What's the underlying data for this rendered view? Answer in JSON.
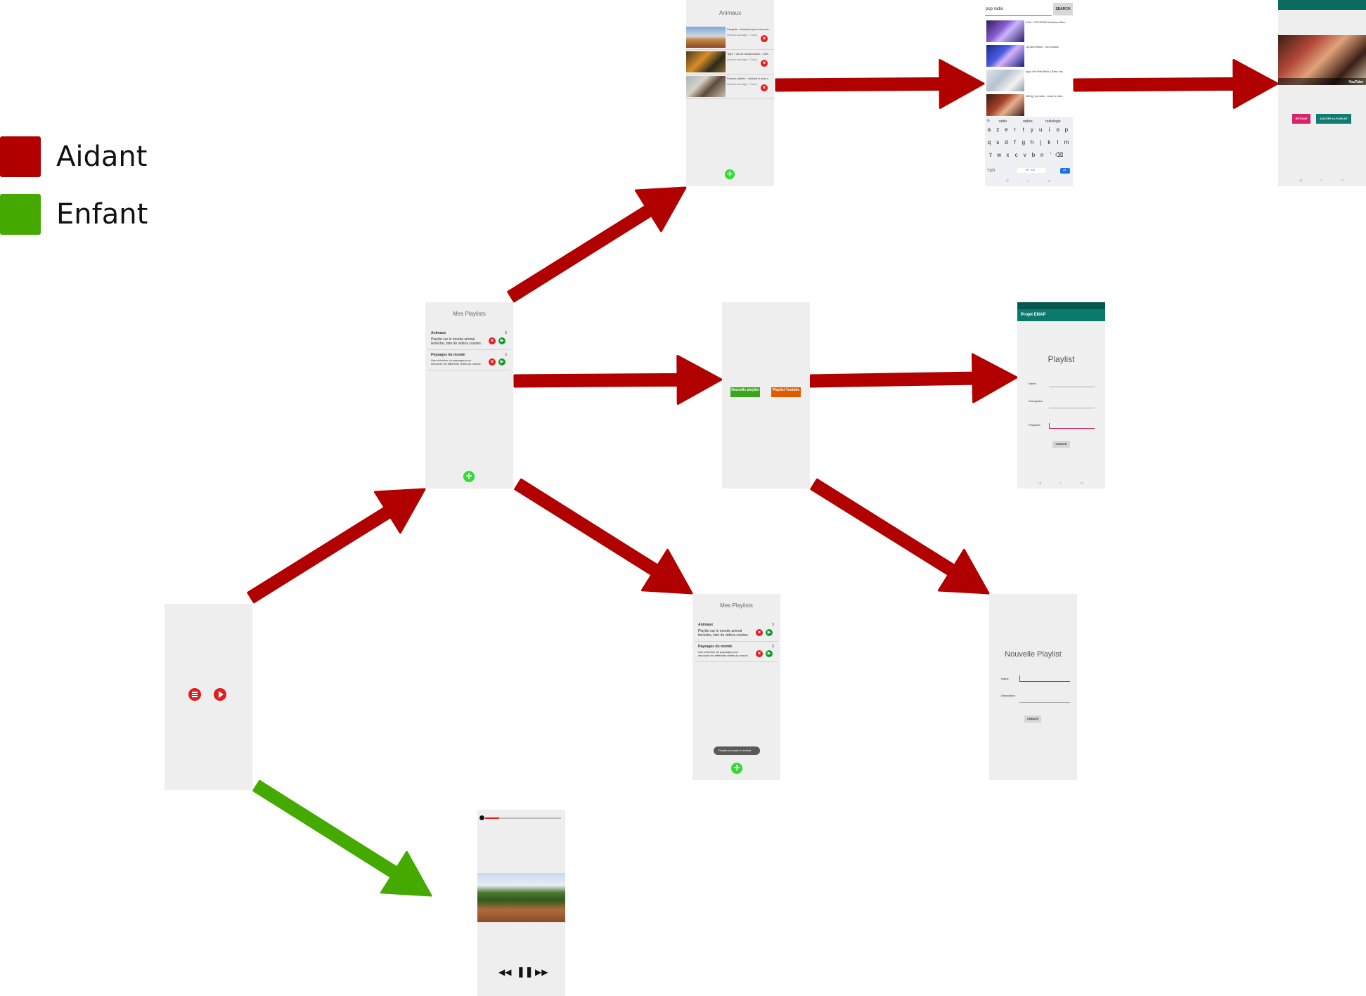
{
  "legend": [
    {
      "label": "Aidant",
      "color": "#b00000"
    },
    {
      "label": "Enfant",
      "color": "#44aa00"
    }
  ],
  "colors": {
    "aidant": "#b00000",
    "enfant": "#44aa00",
    "screen": "#eeeeee"
  },
  "home_screen": {
    "icons": [
      "list-icon",
      "play-icon"
    ]
  },
  "playlists_screen": {
    "title": "Mes Playlists",
    "items": [
      {
        "name": "Animaux",
        "count": "3",
        "desc": "Playlist sur le monde animal terrestre, liste de vidéos courtes"
      },
      {
        "name": "Paysages du monde",
        "count": "3",
        "desc": "Une sélection de paysages pour découvrir les différents reliefs du monde"
      }
    ]
  },
  "playlist_detail_screen": {
    "title": "Animaux",
    "items": [
      {
        "title": "Pangolin : Animal le plus braconn...",
        "meta": "Animaux sauvages · 3 vues"
      },
      {
        "title": "Tigre : Vie de fonctionnaire - Défi...",
        "meta": "Animaux sauvages · 3 vues"
      },
      {
        "title": "Faucon pèlerin : l'animal le plus r...",
        "meta": "Animaux sauvages · 3 vues"
      }
    ]
  },
  "search_screen": {
    "query": "pop radio",
    "search_button": "SEARCH",
    "results": [
      {
        "title": "K/DA - POP/STARS ft Madison Beer..."
      },
      {
        "title": "Lily Allen Radio - Tom Kerland"
      },
      {
        "title": "Appy Life Pride Radio | Radio hall..."
      },
      {
        "title": "365 fig | top radio - music to relax..."
      }
    ],
    "suggestions": [
      "radio",
      "radios",
      "radiologie"
    ],
    "keyboard_rows": [
      [
        "a",
        "z",
        "e",
        "r",
        "t",
        "y",
        "u",
        "i",
        "o",
        "p"
      ],
      [
        "q",
        "s",
        "d",
        "f",
        "g",
        "h",
        "j",
        "k",
        "l",
        "m"
      ],
      [
        "⇧",
        "w",
        "x",
        "c",
        "v",
        "b",
        "n",
        "'",
        "⌫"
      ]
    ],
    "keyboard_bottom": [
      "?123",
      "FR · EN",
      "↵"
    ]
  },
  "video_preview_screen": {
    "video_label": "YouTube",
    "buttons": [
      "RETOUR",
      "AJOUTER LA PLAYLIST"
    ]
  },
  "choice_screen": {
    "buttons": [
      "Nouvelle playlist",
      "Playlist Youtube"
    ]
  },
  "youtube_playlist_form": {
    "app_bar": "Projet ENAP",
    "title": "Playlist",
    "fields": [
      "Name",
      "Description",
      "PlaylistID"
    ],
    "button": "CREATE"
  },
  "new_playlist_form": {
    "title": "Nouvelle Playlist",
    "fields": [
      "Name",
      "Description"
    ],
    "button": "CREATE"
  },
  "playlists_sent_screen": {
    "title": "Mes Playlists",
    "items": [
      {
        "name": "Animaux",
        "count": "3",
        "desc": "Playlist sur le monde animal terrestre, liste de vidéos courtes"
      },
      {
        "name": "Paysages du monde",
        "count": "3",
        "desc": "Une sélection de paysages pour découvrir les différents reliefs du monde"
      }
    ],
    "toast": "Playlist envoyée à l'enfant"
  },
  "player_screen": {
    "progress": 0.22,
    "controls": [
      "previous-icon",
      "pause-icon",
      "next-icon"
    ]
  }
}
